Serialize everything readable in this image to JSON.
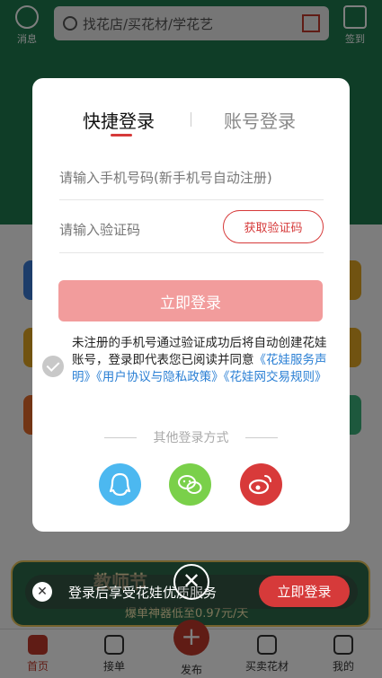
{
  "background": {
    "header": {
      "messages_label": "消息",
      "search_placeholder": "找花店/买花材/学花艺",
      "checkin_label": "签到"
    },
    "promo": {
      "title": "教师节",
      "subtitle": "爆单神器低至0.97元/天"
    },
    "tabbar": [
      {
        "label": "首页",
        "icon": "home-icon"
      },
      {
        "label": "接单",
        "icon": "order-icon"
      },
      {
        "label": "发布",
        "icon": "plus-icon"
      },
      {
        "label": "买卖花材",
        "icon": "flower-icon"
      },
      {
        "label": "我的",
        "icon": "user-icon"
      }
    ]
  },
  "modal": {
    "tabs": {
      "quick": "快捷登录",
      "account": "账号登录"
    },
    "phone_placeholder": "请输入手机号码(新手机号自动注册)",
    "code_placeholder": "请输入验证码",
    "get_code_label": "获取验证码",
    "login_label": "立即登录",
    "agreement": {
      "text": "未注册的手机号通过验证成功后将自动创建花娃账号，登录即代表您已阅读并同意",
      "link1": "《花娃服务声明》",
      "link2": "《用户协议与隐私政策》",
      "link3": "《花娃网交易规则》"
    },
    "other_methods_title": "其他登录方式",
    "social": [
      {
        "name": "qq",
        "icon": "qq-icon",
        "color": "#4cb8f0"
      },
      {
        "name": "wechat",
        "icon": "wechat-icon",
        "color": "#7ad04a"
      },
      {
        "name": "weibo",
        "icon": "weibo-icon",
        "color": "#d83a3a"
      }
    ]
  },
  "banner": {
    "text": "登录后享受花娃优质服务",
    "login_label": "立即登录"
  },
  "colors": {
    "accent": "#d63a3a",
    "login_disabled": "#f29c9c",
    "link": "#2a7fd4"
  }
}
